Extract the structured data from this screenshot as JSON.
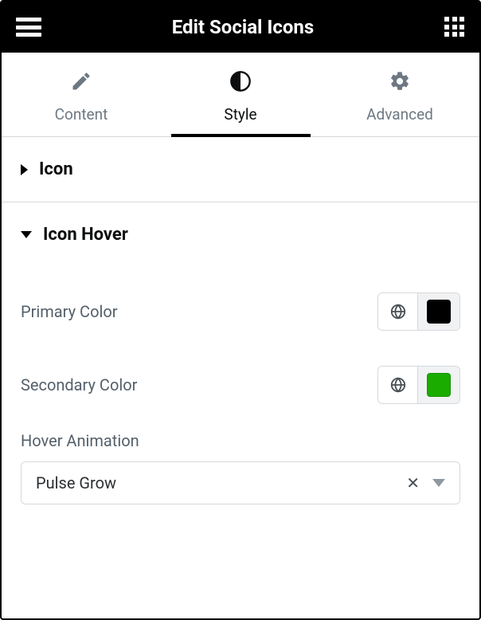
{
  "header": {
    "title": "Edit Social Icons"
  },
  "tabs": {
    "content": {
      "label": "Content"
    },
    "style": {
      "label": "Style"
    },
    "advanced": {
      "label": "Advanced"
    }
  },
  "sections": {
    "icon": {
      "title": "Icon"
    },
    "icon_hover": {
      "title": "Icon Hover"
    }
  },
  "controls": {
    "primary_color": {
      "label": "Primary Color",
      "value": "#000000"
    },
    "secondary_color": {
      "label": "Secondary Color",
      "value": "#1bac00"
    },
    "hover_animation": {
      "label": "Hover Animation",
      "value": "Pulse Grow"
    }
  }
}
